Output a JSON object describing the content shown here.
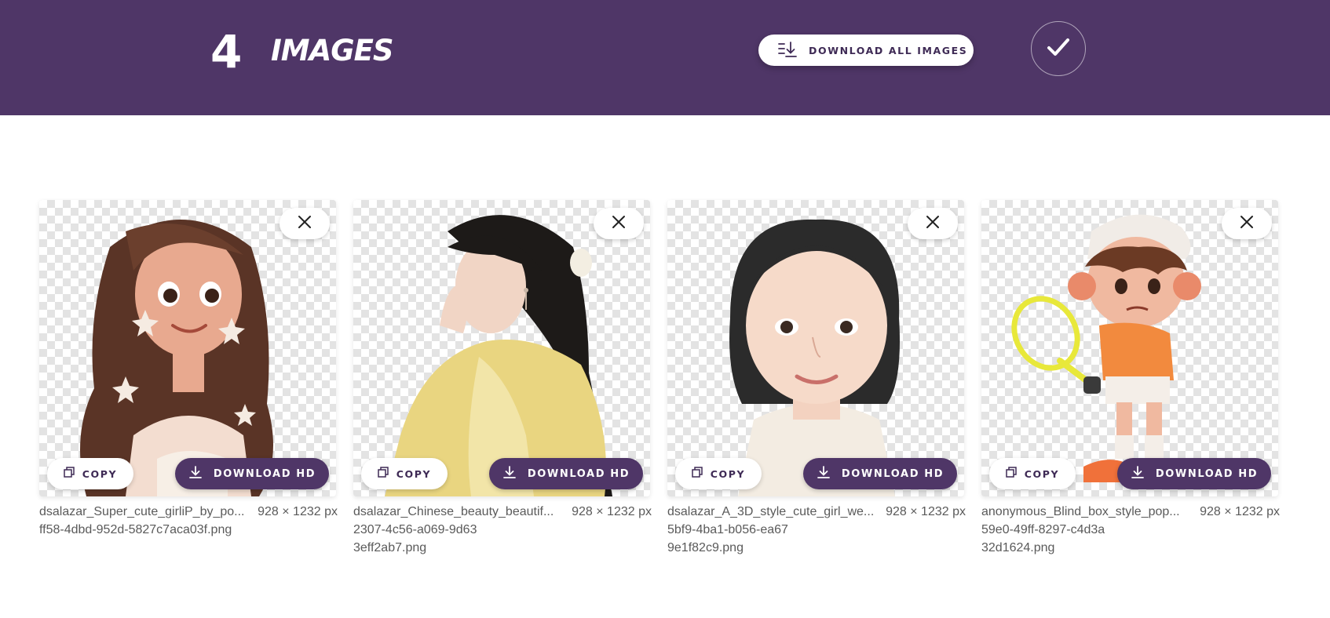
{
  "header": {
    "count": "4",
    "count_label": "IMAGES",
    "download_all_label": "DOWNLOAD ALL IMAGES"
  },
  "colors": {
    "brand": "#4f3667",
    "button_text": "#3e2a55",
    "checker": "#e3e3e3"
  },
  "icons": {
    "download_all": "download-list-icon",
    "confirm": "check-icon",
    "close": "close-icon",
    "copy": "copy-icon",
    "download": "download-icon"
  },
  "images": [
    {
      "name_line": "dsalazar_Super_cute_girliP_by_po...",
      "name_rest": "ff58-4dbd-952d-5827c7aca03f.png",
      "dimensions": "928 × 1232 px",
      "copy_label": "COPY",
      "download_label": "DOWNLOAD HD",
      "subject": "cartoon-girl"
    },
    {
      "name_line": "dsalazar_Chinese_beauty_beautif...",
      "name_rest": "2307-4c56-a069-9d633eff2ab7.png",
      "dimensions": "928 × 1232 px",
      "copy_label": "COPY",
      "download_label": "DOWNLOAD HD",
      "subject": "woman-yellow-robe"
    },
    {
      "name_line": "dsalazar_A_3D_style_cute_girl_we...",
      "name_rest": "5bf9-4ba1-b056-ea679e1f82c9.png",
      "dimensions": "928 × 1232 px",
      "copy_label": "COPY",
      "download_label": "DOWNLOAD HD",
      "subject": "3d-girl-portrait"
    },
    {
      "name_line": "anonymous_Blind_box_style_pop...",
      "name_rest": "59e0-49ff-8297-c4d3a32d1624.png",
      "dimensions": "928 × 1232 px",
      "copy_label": "COPY",
      "download_label": "DOWNLOAD HD",
      "subject": "tennis-figure"
    }
  ]
}
